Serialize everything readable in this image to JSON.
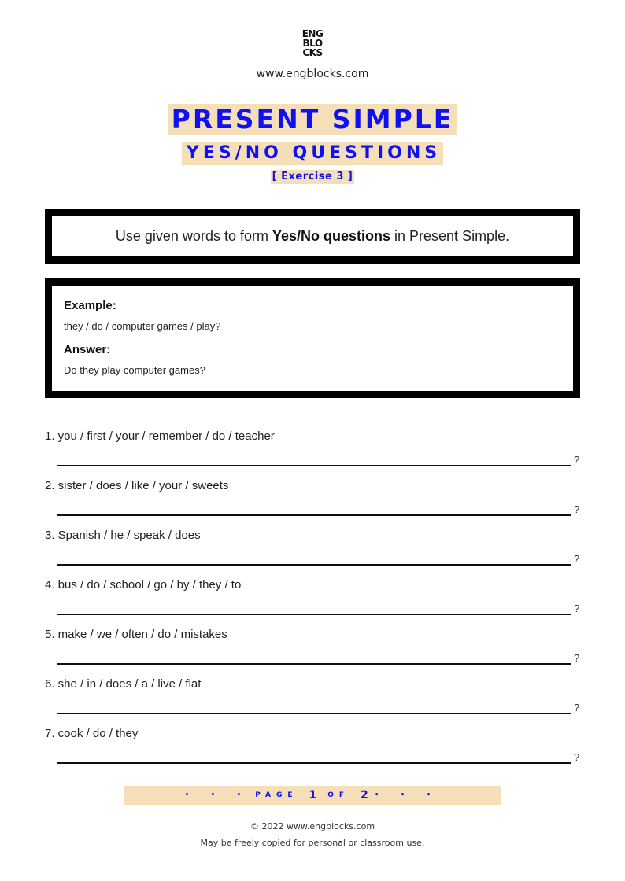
{
  "header": {
    "logo_lines": [
      "ENG",
      "BLO",
      "CKS"
    ],
    "site_url": "www.engblocks.com",
    "title": "PRESENT SIMPLE",
    "subtitle": "YES/NO QUESTIONS",
    "exercise": "[ Exercise 3 ]"
  },
  "instruction": {
    "before": "Use given words to form ",
    "bold": "Yes/No questions",
    "after": " in Present Simple."
  },
  "example": {
    "example_label": "Example:",
    "example_text": "they / do / computer games / play?",
    "answer_label": "Answer:",
    "answer_text": "Do they play computer games?"
  },
  "questions": [
    {
      "text": "1. you / first / your / remember / do / teacher",
      "end_mark": "?"
    },
    {
      "text": "2. sister / does / like / your / sweets",
      "end_mark": "?"
    },
    {
      "text": "3. Spanish / he / speak / does",
      "end_mark": "?"
    },
    {
      "text": "4. bus / do / school / go / by / they / to",
      "end_mark": "?"
    },
    {
      "text": "5. make / we / often / do / mistakes",
      "end_mark": "?"
    },
    {
      "text": "6. she / in / does / a / live / flat",
      "end_mark": "?"
    },
    {
      "text": "7. cook / do / they",
      "end_mark": "?"
    }
  ],
  "footer": {
    "dots": "• • •",
    "page_word": "PAGE",
    "current_page": "1",
    "of_word": "OF",
    "total_pages": "2",
    "copyright": "© 2022 www.engblocks.com",
    "license": "May be freely copied for personal or classroom use."
  },
  "colors": {
    "accent_blue": "#1010f0",
    "highlight_beige": "#f5dfb8",
    "border_black": "#000000"
  }
}
